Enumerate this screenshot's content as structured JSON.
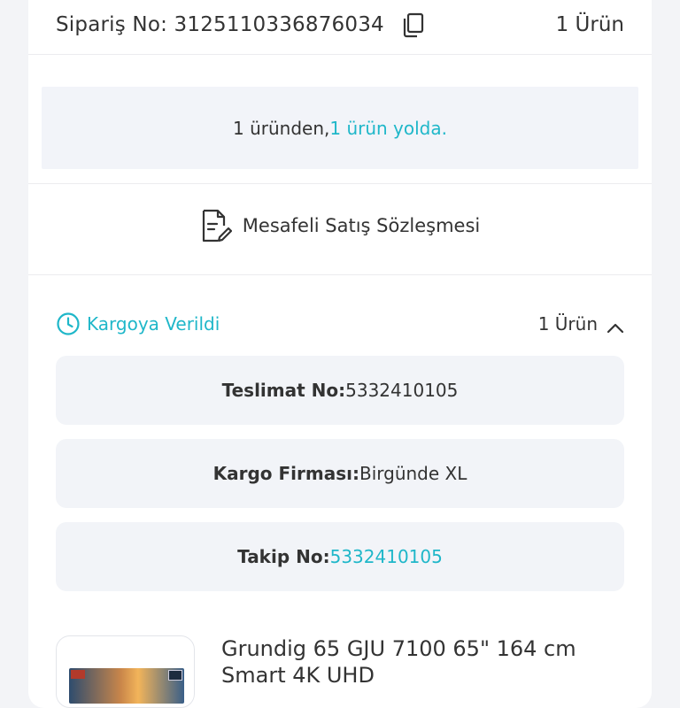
{
  "order": {
    "number_label": "Sipariş No: 3125110336876034",
    "count_label": "1 Ürün"
  },
  "summary": {
    "prefix": "1 üründen, ",
    "highlight": "1 ürün yolda."
  },
  "contract": {
    "label": "Mesafeli Satış Sözleşmesi"
  },
  "shipment": {
    "status_label": "Kargoya Verildi",
    "count_label": "1 Ürün",
    "delivery": {
      "label": "Teslimat No:",
      "value": "5332410105"
    },
    "carrier": {
      "label": "Kargo Firması:",
      "value": "Birgünde XL"
    },
    "tracking": {
      "label": "Takip No:",
      "value": "5332410105"
    }
  },
  "product": {
    "title": "Grundig 65 GJU 7100 65\" 164 cm Smart 4K UHD",
    "image_badge_left": "",
    "image_badge_right": "4K"
  },
  "colors": {
    "accent": "#1fb7c9",
    "background": "#f3f4f7",
    "card": "#ffffff",
    "info_box": "#f2f4f8"
  },
  "icons": {
    "copy": "copy-icon",
    "contract": "document-edit-icon",
    "clock": "clock-icon",
    "chevron": "chevron-up-icon"
  }
}
